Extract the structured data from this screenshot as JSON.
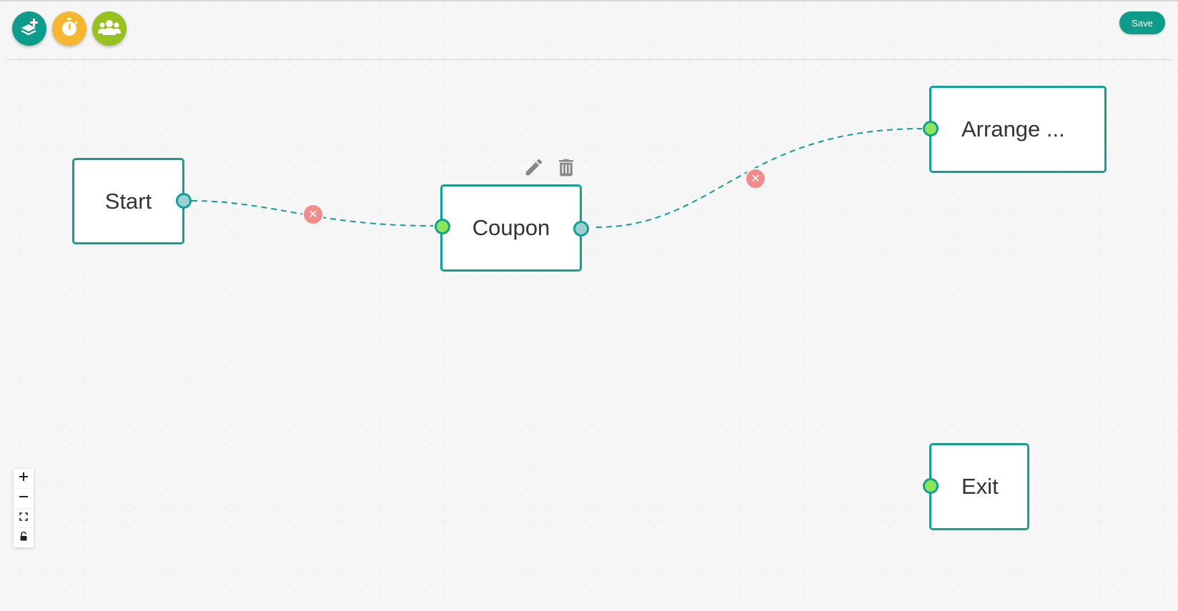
{
  "toolbar": {
    "buttons": [
      {
        "name": "add-step-button",
        "icon": "layers-plus-icon",
        "color": "#0d9b8c"
      },
      {
        "name": "add-timer-button",
        "icon": "stopwatch-icon",
        "color": "#f5b731"
      },
      {
        "name": "add-audience-button",
        "icon": "users-group-icon",
        "color": "#96c11f"
      }
    ],
    "save_label": "Save"
  },
  "nodes": {
    "start": {
      "label": "Start"
    },
    "coupon": {
      "label": "Coupon"
    },
    "arrange": {
      "label": "Arrange ..."
    },
    "exit": {
      "label": "Exit"
    }
  },
  "node_actions": {
    "edit_icon": "pencil-icon",
    "delete_icon": "trash-icon"
  },
  "zoom_controls": {
    "items": [
      "zoom-in-icon",
      "zoom-out-icon",
      "fit-view-icon",
      "lock-icon"
    ]
  },
  "colors": {
    "accent": "#0d9b8c",
    "node_border": "#11a091",
    "port_in": "#8ce65a",
    "port_out": "#9ccfd4",
    "edge_remove": "#f08c8c",
    "edge_line": "#139e93"
  }
}
